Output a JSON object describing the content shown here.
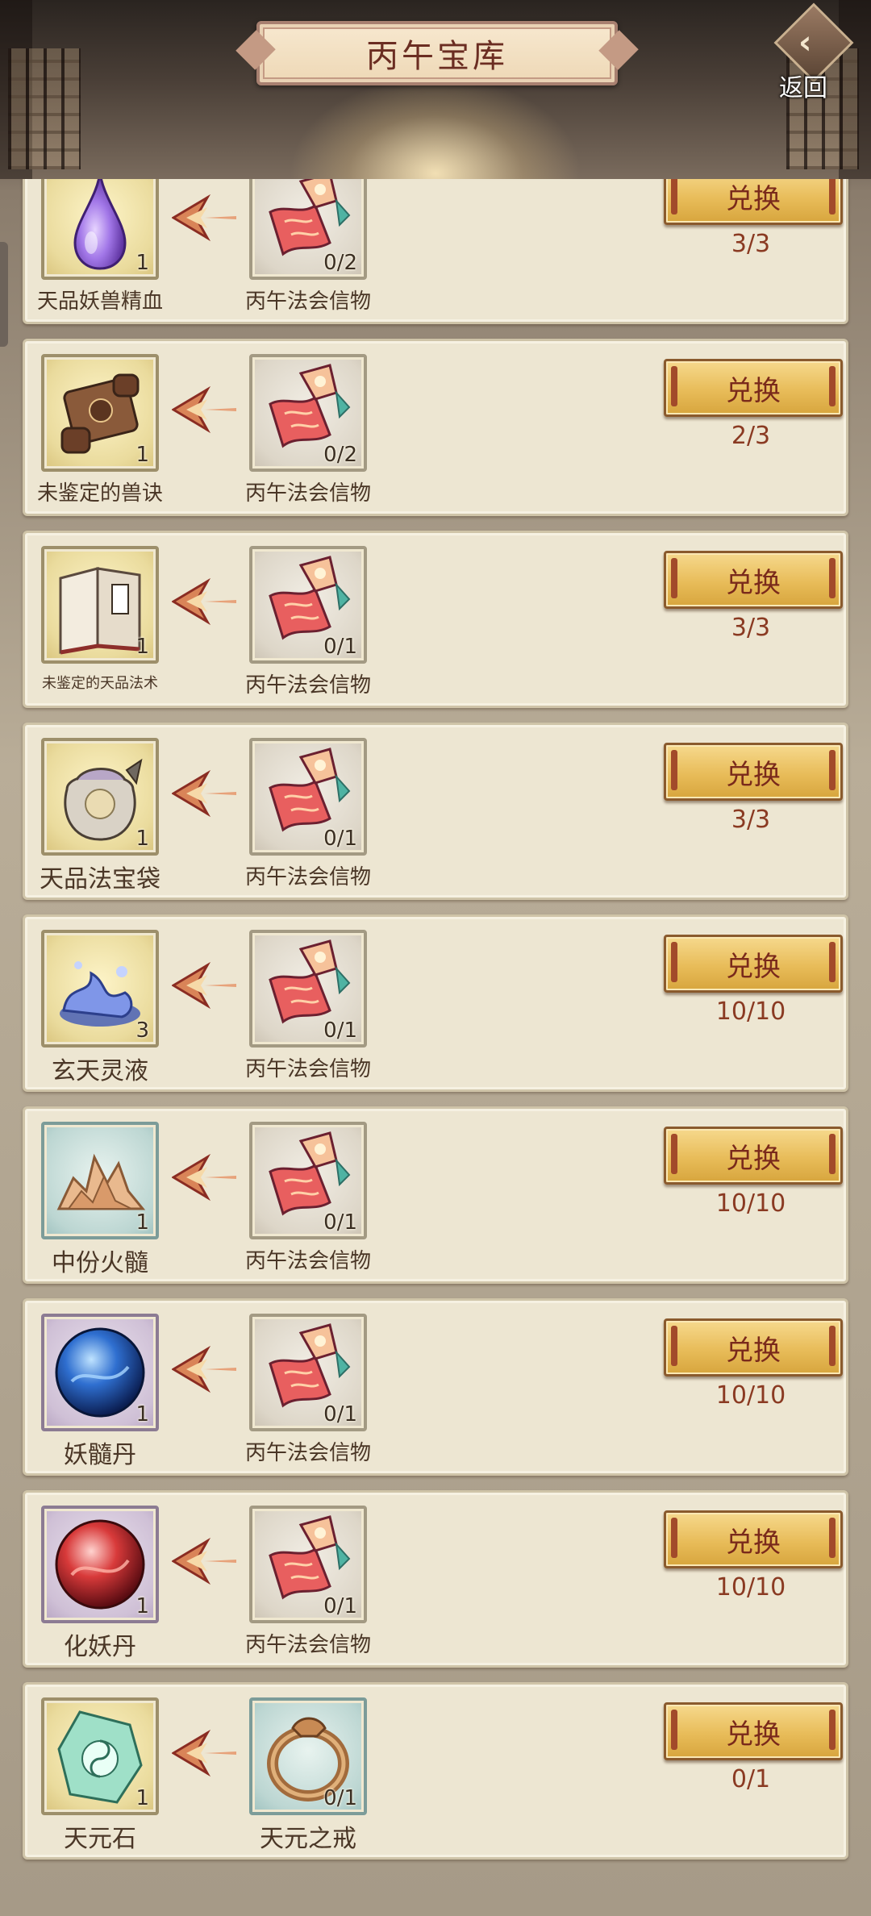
{
  "header": {
    "title": "丙午宝库",
    "back_label": "返回"
  },
  "exchange_label": "兑换",
  "rows": [
    {
      "reward_name": "天品妖兽精血",
      "reward_count": "1",
      "reward_icon": "purple-drop-icon",
      "cost_name": "丙午法会信物",
      "cost_count": "0/2",
      "cost_icon": "festival-token-icon",
      "limit": "3/3"
    },
    {
      "reward_name": "未鉴定的兽诀",
      "reward_count": "1",
      "reward_icon": "scroll-icon",
      "cost_name": "丙午法会信物",
      "cost_count": "0/2",
      "cost_icon": "festival-token-icon",
      "limit": "2/3"
    },
    {
      "reward_name": "未鉴定的天品法术",
      "reward_count": "1",
      "reward_icon": "book-icon",
      "cost_name": "丙午法会信物",
      "cost_count": "0/1",
      "cost_icon": "festival-token-icon",
      "limit": "3/3"
    },
    {
      "reward_name": "天品法宝袋",
      "reward_count": "1",
      "reward_icon": "treasure-bag-icon",
      "cost_name": "丙午法会信物",
      "cost_count": "0/1",
      "cost_icon": "festival-token-icon",
      "limit": "3/3"
    },
    {
      "reward_name": "玄天灵液",
      "reward_count": "3",
      "reward_icon": "spirit-liquid-icon",
      "cost_name": "丙午法会信物",
      "cost_count": "0/1",
      "cost_icon": "festival-token-icon",
      "limit": "10/10"
    },
    {
      "reward_name": "中份火髓",
      "reward_count": "1",
      "reward_icon": "fire-marrow-icon",
      "cost_name": "丙午法会信物",
      "cost_count": "0/1",
      "cost_icon": "festival-token-icon",
      "limit": "10/10"
    },
    {
      "reward_name": "妖髓丹",
      "reward_count": "1",
      "reward_icon": "blue-pill-icon",
      "cost_name": "丙午法会信物",
      "cost_count": "0/1",
      "cost_icon": "festival-token-icon",
      "limit": "10/10"
    },
    {
      "reward_name": "化妖丹",
      "reward_count": "1",
      "reward_icon": "red-pill-icon",
      "cost_name": "丙午法会信物",
      "cost_count": "0/1",
      "cost_icon": "festival-token-icon",
      "limit": "10/10"
    },
    {
      "reward_name": "天元石",
      "reward_count": "1",
      "reward_icon": "jade-stone-icon",
      "cost_name": "天元之戒",
      "cost_count": "0/1",
      "cost_icon": "ring-icon",
      "limit": "0/1"
    }
  ]
}
